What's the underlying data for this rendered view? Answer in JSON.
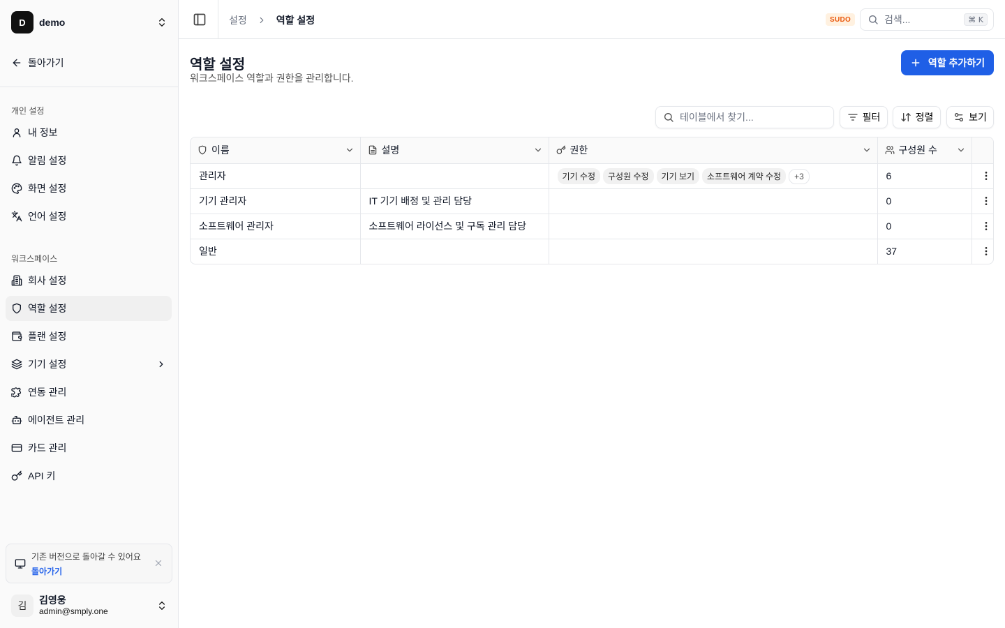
{
  "workspace": {
    "initial": "D",
    "name": "demo"
  },
  "sidebar": {
    "back_label": "돌아가기",
    "personal_group": "개인 설정",
    "personal_items": [
      {
        "label": "내 정보",
        "icon": "user-icon"
      },
      {
        "label": "알림 설정",
        "icon": "bell-icon"
      },
      {
        "label": "화면 설정",
        "icon": "palette-icon"
      },
      {
        "label": "언어 설정",
        "icon": "languages-icon"
      }
    ],
    "workspace_group": "워크스페이스",
    "workspace_items": [
      {
        "label": "회사 설정",
        "icon": "building-icon"
      },
      {
        "label": "역할 설정",
        "icon": "shield-icon",
        "active": true
      },
      {
        "label": "플랜 설정",
        "icon": "wallet-icon"
      },
      {
        "label": "기기 설정",
        "icon": "layers-icon",
        "has_children": true
      },
      {
        "label": "연동 관리",
        "icon": "puzzle-icon"
      },
      {
        "label": "에이전트 관리",
        "icon": "bot-icon"
      },
      {
        "label": "카드 관리",
        "icon": "credit-card-icon"
      },
      {
        "label": "API 키",
        "icon": "key-icon"
      }
    ],
    "notice": {
      "text": "기존 버전으로 돌아갈 수 있어요",
      "link": "돌아가기"
    },
    "user": {
      "initial": "김",
      "name": "김영웅",
      "email": "admin@smply.one"
    }
  },
  "header": {
    "breadcrumb": [
      "설정",
      "역할 설정"
    ],
    "badge": "SUDO",
    "search_placeholder": "검색...",
    "shortcut": "⌘ K"
  },
  "main": {
    "title": "역할 설정",
    "description": "워크스페이스 역할과 권한을 관리합니다.",
    "add_button": "역할 추가하기",
    "table_search_placeholder": "테이블에서 찾기...",
    "filter_label": "필터",
    "sort_label": "정렬",
    "view_label": "보기",
    "columns": [
      "이름",
      "설명",
      "권한",
      "구성원 수"
    ],
    "rows": [
      {
        "name": "관리자",
        "description": "",
        "permissions": [
          "기기 수정",
          "구성원 수정",
          "기기 보기",
          "소프트웨어 계약 수정"
        ],
        "more": "+3",
        "members": "6"
      },
      {
        "name": "기기 관리자",
        "description": "IT 기기 배정 및 관리 담당",
        "permissions": [],
        "more": "",
        "members": "0"
      },
      {
        "name": "소프트웨어 관리자",
        "description": "소프트웨어 라이선스 및 구독 관리 담당",
        "permissions": [],
        "more": "",
        "members": "0"
      },
      {
        "name": "일반",
        "description": "",
        "permissions": [],
        "more": "",
        "members": "37"
      }
    ]
  }
}
